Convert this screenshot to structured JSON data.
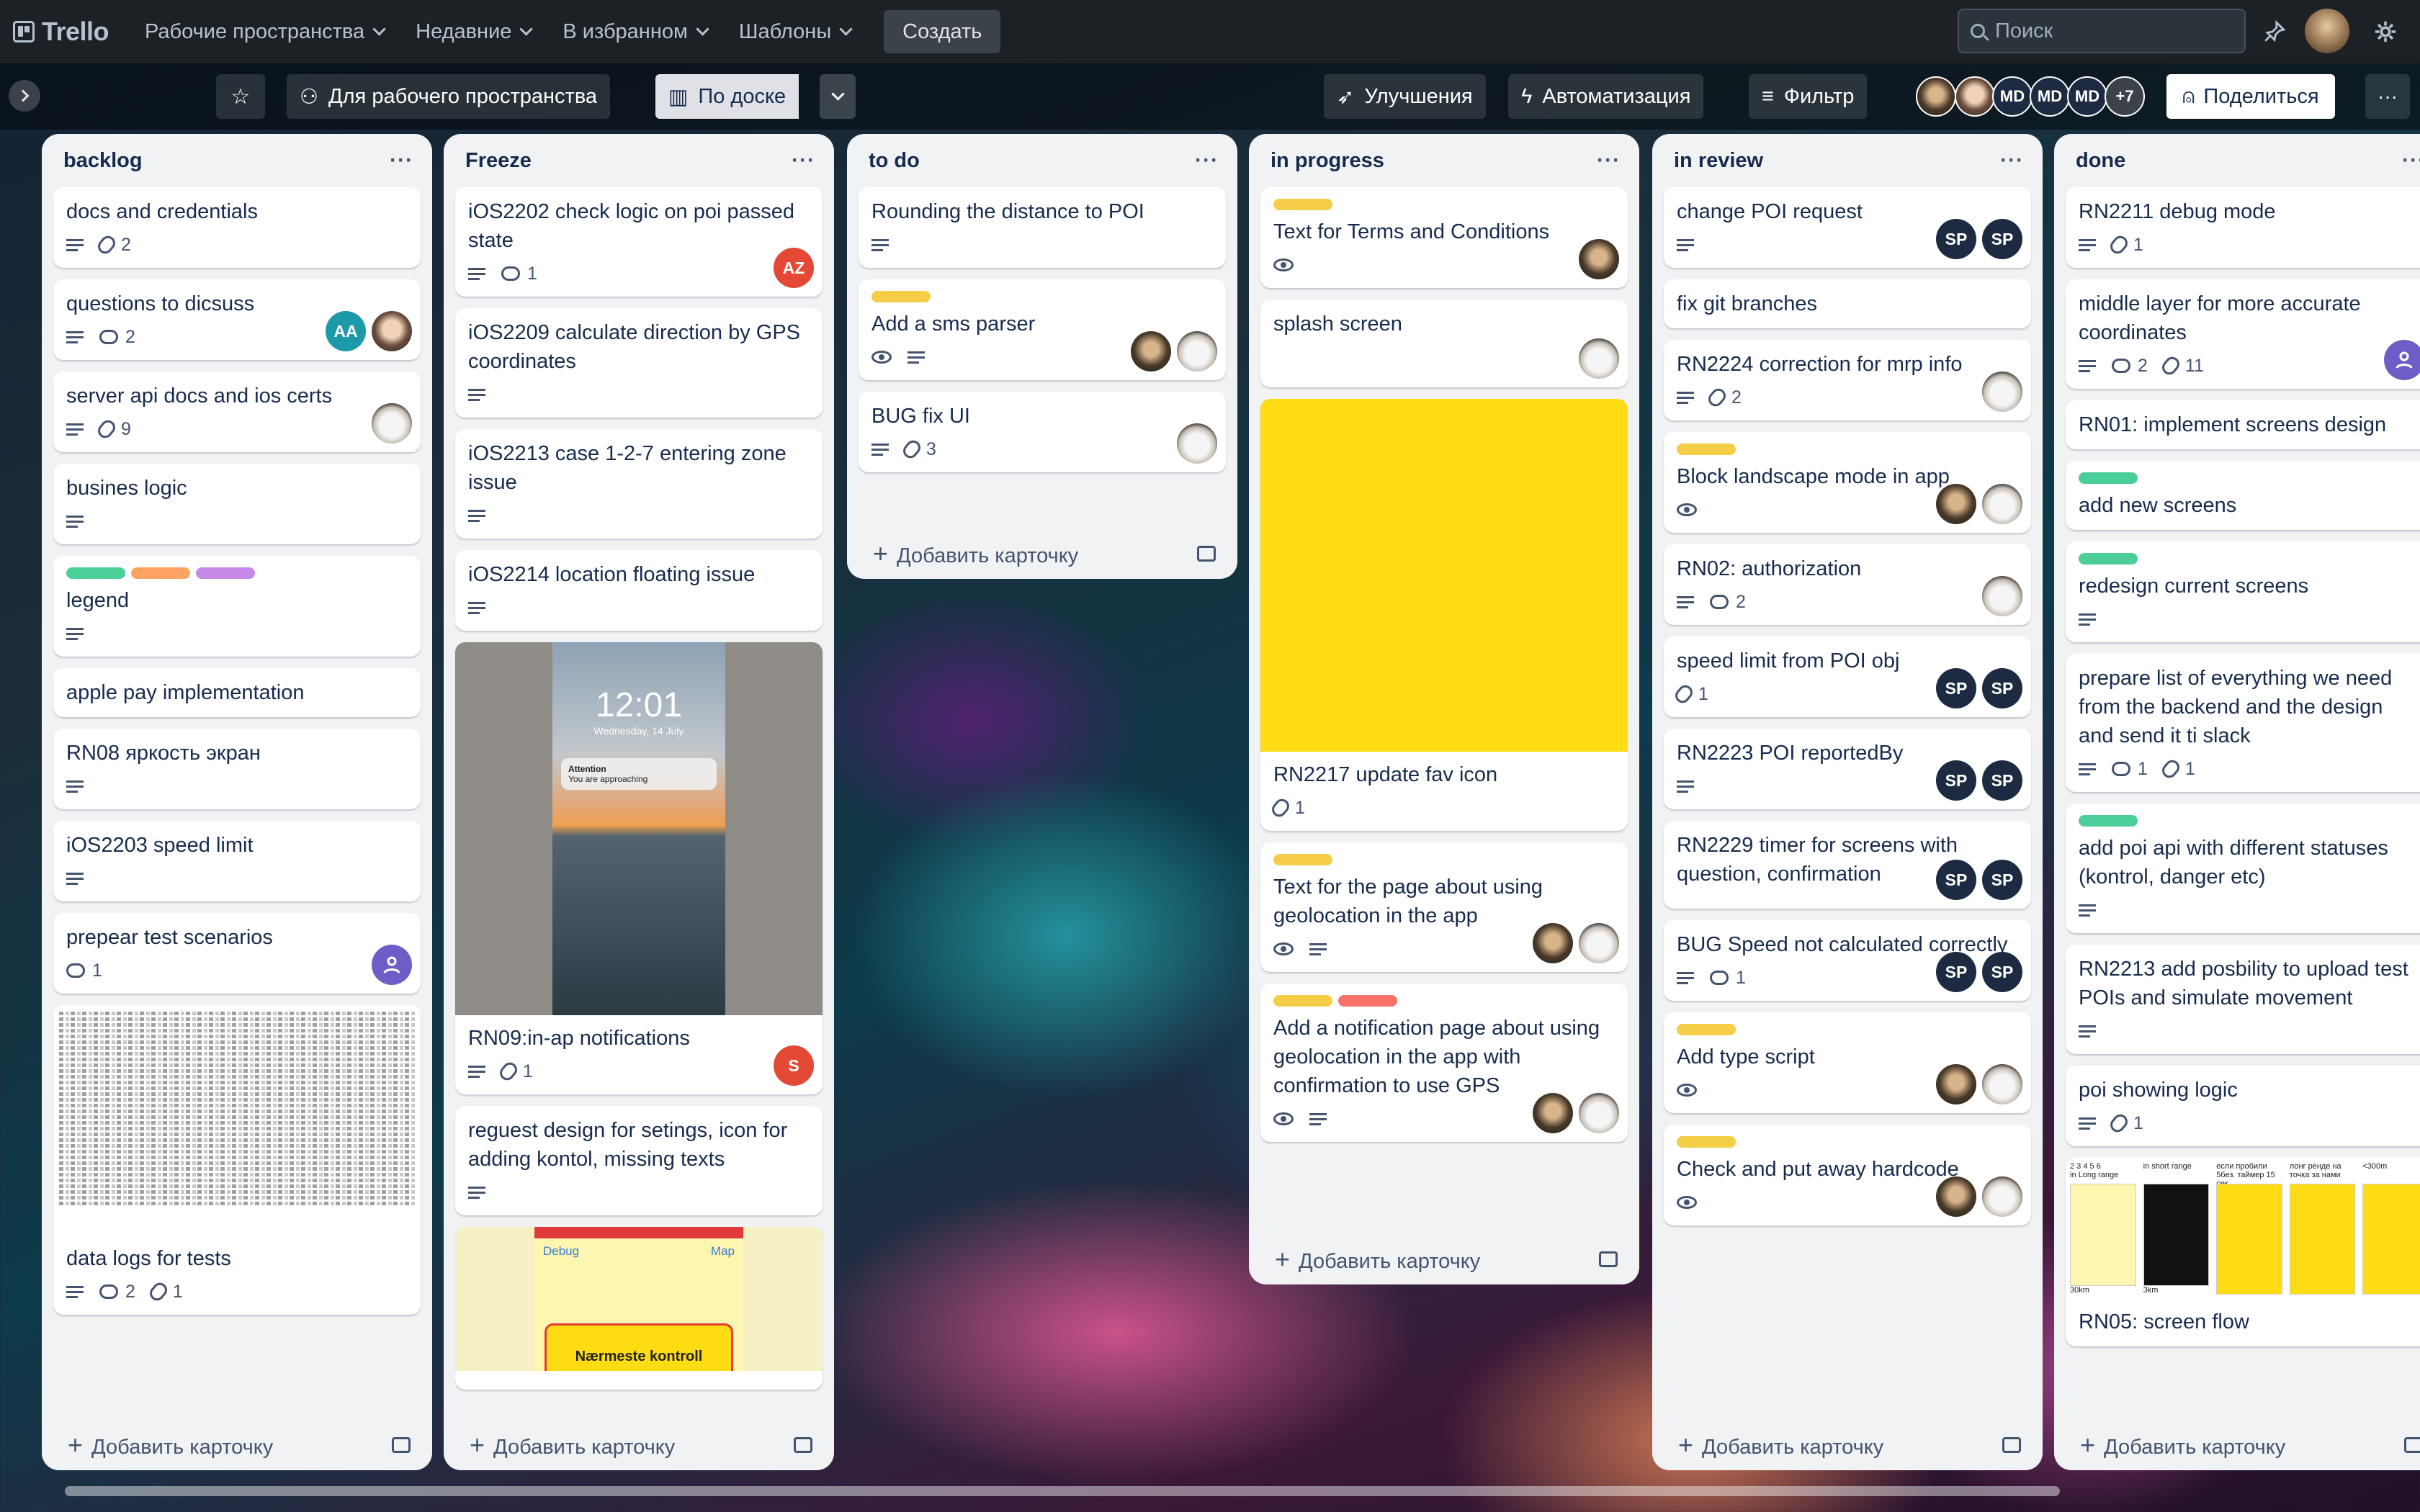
{
  "header": {
    "brand": "Trello",
    "nav": [
      "Рабочие пространства",
      "Недавние",
      "В избранном",
      "Шаблоны"
    ],
    "create_label": "Создать",
    "search_placeholder": "Поиск"
  },
  "boardbar": {
    "workspace_label": "Для рабочего пространства",
    "view_label": "По доске",
    "powerups_label": "Улучшения",
    "automation_label": "Автоматизация",
    "filter_label": "Фильтр",
    "members": [
      "MD",
      "MD",
      "MD"
    ],
    "members_more": "+7",
    "share_label": "Поделиться"
  },
  "add_card_label": "Добавить карточку",
  "colors": {
    "green": "#4bce97",
    "orange": "#fea362",
    "purple": "#c88ae8",
    "yellow": "#f5cd47",
    "red": "#f87168",
    "sp": "#1c2b42",
    "aa": "#1d9aaa",
    "az": "#e34935",
    "purple_av": "#6e5dc6"
  },
  "lists": [
    {
      "title": "backlog",
      "cards": [
        {
          "title": "docs and credentials",
          "desc": true,
          "attach": "2"
        },
        {
          "title": "questions to dicsuss",
          "desc": true,
          "comments": "2",
          "avatars": [
            "AA",
            "face"
          ]
        },
        {
          "title": "server api docs and ios certs",
          "desc": true,
          "attach": "9",
          "avatars": [
            "cat"
          ]
        },
        {
          "title": "busines logic",
          "desc": true
        },
        {
          "title": "legend",
          "labels": [
            "green",
            "orange",
            "purple"
          ],
          "desc": true
        },
        {
          "title": "apple pay implementation"
        },
        {
          "title": "RN08 яркость экран",
          "desc": true
        },
        {
          "title": "iOS2203 speed limit",
          "desc": true
        },
        {
          "title": "prepear test scenarios",
          "comments": "1",
          "avatars": [
            "purple"
          ]
        },
        {
          "title": "data logs for tests",
          "cover": "log",
          "desc": true,
          "comments": "2",
          "attach": "1"
        }
      ]
    },
    {
      "title": "Freeze",
      "cards": [
        {
          "title": "iOS2202 check logic on poi passed state",
          "desc": true,
          "comments": "1",
          "avatars": [
            "AZ"
          ]
        },
        {
          "title": "iOS2209 calculate direction by GPS coordinates",
          "desc": true
        },
        {
          "title": "iOS2213 case 1-2-7 entering zone issue",
          "desc": true
        },
        {
          "title": "iOS2214 location floating issue",
          "desc": true
        },
        {
          "title": "RN09:in-ap notifications",
          "cover": "phone",
          "desc": true,
          "attach": "1",
          "avatars": [
            "S"
          ]
        },
        {
          "title": "reguest design for setings, icon for adding kontol, missing texts",
          "desc": true
        },
        {
          "title": "",
          "cover": "app"
        }
      ],
      "phone": {
        "time": "12:01",
        "date": "Wednesday, 14 July",
        "title": "Attention",
        "text": "You are approaching"
      },
      "app": {
        "debug": "Debug",
        "map": "Map",
        "banner": "Nærmeste kontroll"
      }
    },
    {
      "title": "to do",
      "cards": [
        {
          "title": "Rounding the distance to POI",
          "desc": true
        },
        {
          "title": "Add a sms parser",
          "labels": [
            "yellow"
          ],
          "watch": true,
          "desc": true,
          "avatars": [
            "dark",
            "cat"
          ]
        },
        {
          "title": "BUG fix UI",
          "desc": true,
          "attach": "3",
          "avatars": [
            "cat"
          ]
        }
      ]
    },
    {
      "title": "in progress",
      "cards": [
        {
          "title": "Text for Terms and Conditions",
          "labels": [
            "yellow"
          ],
          "watch": true,
          "avatars": [
            "dark"
          ]
        },
        {
          "title": "splash screen",
          "avatars": [
            "cat"
          ]
        },
        {
          "title": "RN2217 update fav icon",
          "cover": "yellow",
          "attach": "1"
        },
        {
          "title": "Text for the page about using geolocation in the app",
          "labels": [
            "yellow"
          ],
          "watch": true,
          "desc": true,
          "avatars": [
            "dark",
            "cat"
          ]
        },
        {
          "title": "Add a notification page about using geolocation in the app with confirmation to use GPS",
          "labels": [
            "yellow",
            "red"
          ],
          "watch": true,
          "desc": true,
          "avatars": [
            "dark",
            "cat"
          ]
        }
      ]
    },
    {
      "title": "in review",
      "cards": [
        {
          "title": "change POI request",
          "desc": true,
          "avatars": [
            "SP",
            "SP"
          ]
        },
        {
          "title": "fix git branches"
        },
        {
          "title": "RN2224 correction for mrp info",
          "desc": true,
          "attach": "2",
          "avatars": [
            "cat"
          ]
        },
        {
          "title": "Block landscape mode in app",
          "labels": [
            "yellow"
          ],
          "watch": true,
          "avatars": [
            "dark",
            "cat"
          ]
        },
        {
          "title": "RN02: authorization",
          "desc": true,
          "comments": "2",
          "avatars": [
            "cat"
          ]
        },
        {
          "title": "speed limit from POI obj",
          "attach": "1",
          "avatars": [
            "SP",
            "SP"
          ]
        },
        {
          "title": "RN2223 POI reportedBy",
          "desc": true,
          "avatars": [
            "SP",
            "SP"
          ]
        },
        {
          "title": "RN2229 timer for screens with question, confirmation",
          "avatars": [
            "SP",
            "SP"
          ]
        },
        {
          "title": "BUG Speed not calculated correctly",
          "desc": true,
          "comments": "1",
          "avatars": [
            "SP",
            "SP"
          ]
        },
        {
          "title": "Add type script",
          "labels": [
            "yellow"
          ],
          "watch": true,
          "avatars": [
            "dark",
            "cat"
          ]
        },
        {
          "title": "Check and put away hardcode",
          "labels": [
            "yellow"
          ],
          "watch": true,
          "avatars": [
            "dark",
            "cat"
          ]
        }
      ]
    },
    {
      "title": "done",
      "cards": [
        {
          "title": "RN2211 debug mode",
          "desc": true,
          "attach": "1"
        },
        {
          "title": "middle layer for more accurate coordinates",
          "desc": true,
          "comments": "2",
          "attach": "11",
          "avatars": [
            "purple"
          ]
        },
        {
          "title": "RN01: implement screens design"
        },
        {
          "title": "add new screens",
          "labels": [
            "green"
          ]
        },
        {
          "title": "redesign current screens",
          "labels": [
            "green"
          ],
          "desc": true
        },
        {
          "title": "prepare list of everything we need from the backend and the design and send it ti slack",
          "desc": true,
          "comments": "1",
          "attach": "1"
        },
        {
          "title": "add poi api with different statuses (kontrol, danger etc)",
          "labels": [
            "green"
          ],
          "desc": true
        },
        {
          "title": "RN2213 add posbility to upload test POIs and simulate movement",
          "desc": true
        },
        {
          "title": "poi showing logic",
          "desc": true,
          "attach": "1"
        },
        {
          "title": "RN05: screen flow",
          "cover": "flow"
        }
      ],
      "flow": {
        "c1": "2 3 4 5 6",
        "c1b": "in Long range",
        "c2": "in short range",
        "c3": "если пробили 5без. таймер 15 сек",
        "c4": "лонг ренде на точка за нами",
        "c5": "<300m",
        "l1": "30km",
        "l2": "3km"
      }
    }
  ]
}
